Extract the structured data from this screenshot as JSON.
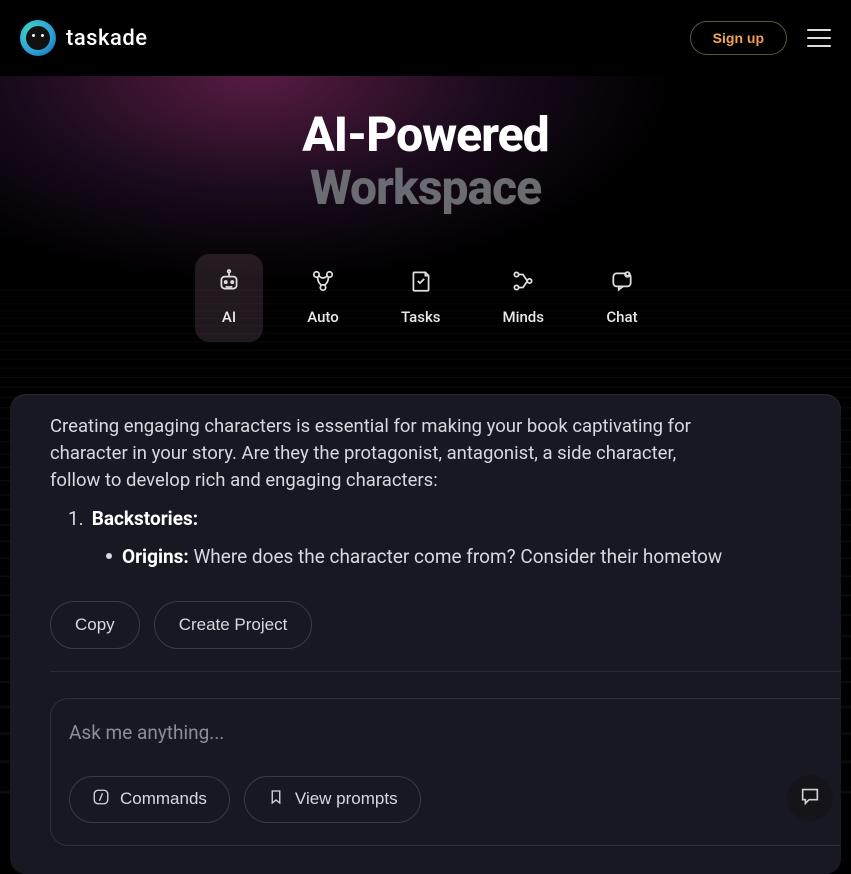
{
  "header": {
    "brand": "taskade",
    "signup_label": "Sign up"
  },
  "hero": {
    "title": "AI-Powered",
    "subtitle": "Workspace"
  },
  "tabs": [
    {
      "id": "ai",
      "label": "AI",
      "active": true
    },
    {
      "id": "auto",
      "label": "Auto",
      "active": false
    },
    {
      "id": "tasks",
      "label": "Tasks",
      "active": false
    },
    {
      "id": "minds",
      "label": "Minds",
      "active": false
    },
    {
      "id": "chat",
      "label": "Chat",
      "active": false
    }
  ],
  "content": {
    "intro_line1": "Creating engaging characters is essential for making your book captivating for",
    "intro_line2": "character in your story. Are they the protagonist, antagonist, a side character, ",
    "intro_line3": "follow to develop rich and engaging characters:",
    "ol_number": "1.",
    "ol_label": "Backstories:",
    "ul_label": "Origins:",
    "ul_text": "Where does the character come from? Consider their hometow",
    "copy_label": "Copy",
    "create_project_label": "Create Project"
  },
  "prompt": {
    "placeholder": "Ask me anything...",
    "commands_label": "Commands",
    "view_prompts_label": "View prompts"
  }
}
